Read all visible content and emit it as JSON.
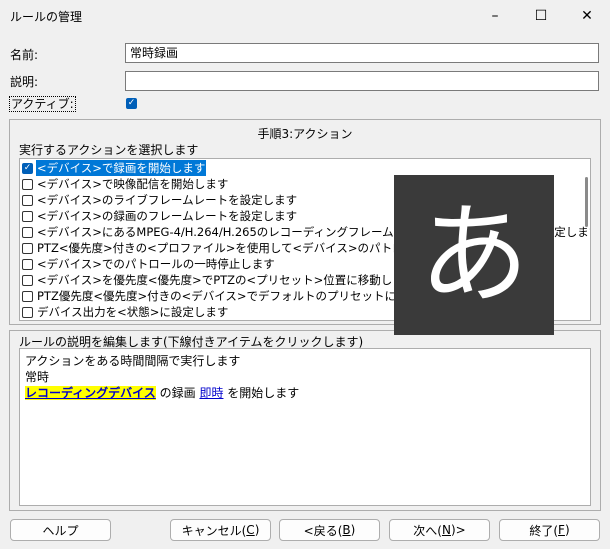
{
  "window": {
    "title": "ルールの管理",
    "minimize": "–",
    "maximize": "☐",
    "close": "✕"
  },
  "form": {
    "name_label": "名前:",
    "name_value": "常時録画",
    "desc_label": "説明:",
    "desc_value": "",
    "active_label": "アクティブ:",
    "active_checked": "✓"
  },
  "actions_panel": {
    "step_title": "手順3:アクション",
    "select_label": "実行するアクションを選択します",
    "items": [
      {
        "label": "<デバイス>で録画を開始します",
        "checked": "✓"
      },
      {
        "label": "<デバイス>で映像配信を開始します",
        "checked": ""
      },
      {
        "label": "<デバイス>のライブフレームレートを設定します",
        "checked": ""
      },
      {
        "label": "<デバイス>の録画のフレームレートを設定します",
        "checked": ""
      },
      {
        "label": "<デバイス>にあるMPEG-4/H.264/H.265のレコーディングフレームレートを全フレームレートに設定します",
        "checked": ""
      },
      {
        "label": "PTZ<優先度>付きの<プロファイル>を使用して<デバイス>のパトロールを開始します",
        "checked": ""
      },
      {
        "label": "<デバイス>でのパトロールの一時停止します",
        "checked": ""
      },
      {
        "label": "<デバイス>を優先度<優先度>でPTZの<プリセット>位置に移動します",
        "checked": ""
      },
      {
        "label": "PTZ優先度<優先度>付きの<デバイス>でデフォルトのプリセットに移動します",
        "checked": ""
      },
      {
        "label": "デバイス出力を<状態>に設定します",
        "checked": ""
      }
    ]
  },
  "description_panel": {
    "edit_label": "ルールの説明を編集します(下線付きアイテムをクリックします)",
    "line1": "アクションをある時間間隔で実行します",
    "line2": "常時",
    "line3_link1": "レコーディングデバイス",
    "line3_text1": " の録画 ",
    "line3_link2": "即時",
    "line3_text2": " を開始します"
  },
  "buttons": {
    "help": "ヘルプ",
    "cancel": "キャンセル(",
    "cancel_key": "C",
    "cancel_end": ")",
    "back": "<戻る(",
    "back_key": "B",
    "back_end": ")",
    "next": "次へ(",
    "next_key": "N",
    "next_end": ")>",
    "finish": "終了(",
    "finish_key": "F",
    "finish_end": ")"
  },
  "ime_indicator": {
    "glyph": "あ"
  }
}
